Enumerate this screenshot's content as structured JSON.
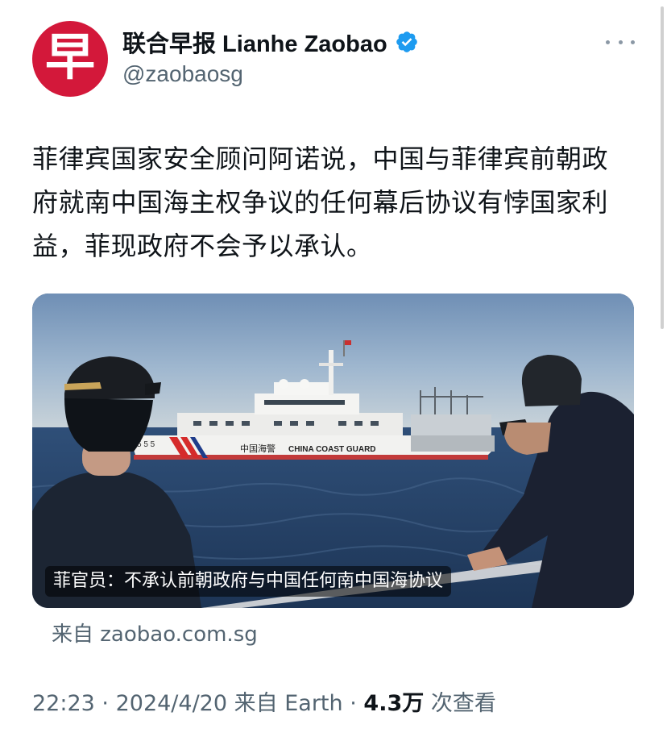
{
  "author": {
    "avatar_glyph": "早",
    "display_name": "联合早报 Lianhe Zaobao",
    "handle": "@zaobaosg",
    "verified": true,
    "brand_color": "#d3183a",
    "verified_color": "#1d9bf0"
  },
  "tweet": {
    "text": "菲律宾国家安全顾问阿诺说，中国与菲律宾前朝政府就南中国海主权争议的任何幕后协议有悖国家利益，菲现政府不会予以承认。"
  },
  "media": {
    "caption": "菲官员：不承认前朝政府与中国任何南中国海协议",
    "ship_label_cn": "中国海警",
    "ship_label_en": "CHINA   COAST  GUARD",
    "hull_number": "5 5 5",
    "source_text": "来自 zaobao.com.sg"
  },
  "meta": {
    "time": "22:23",
    "date": "2024/4/20",
    "source": "来自 Earth",
    "views_count": "4.3万",
    "views_label": "次查看",
    "separator": "·"
  },
  "colors": {
    "text_primary": "#0f1419",
    "text_secondary": "#536471"
  }
}
